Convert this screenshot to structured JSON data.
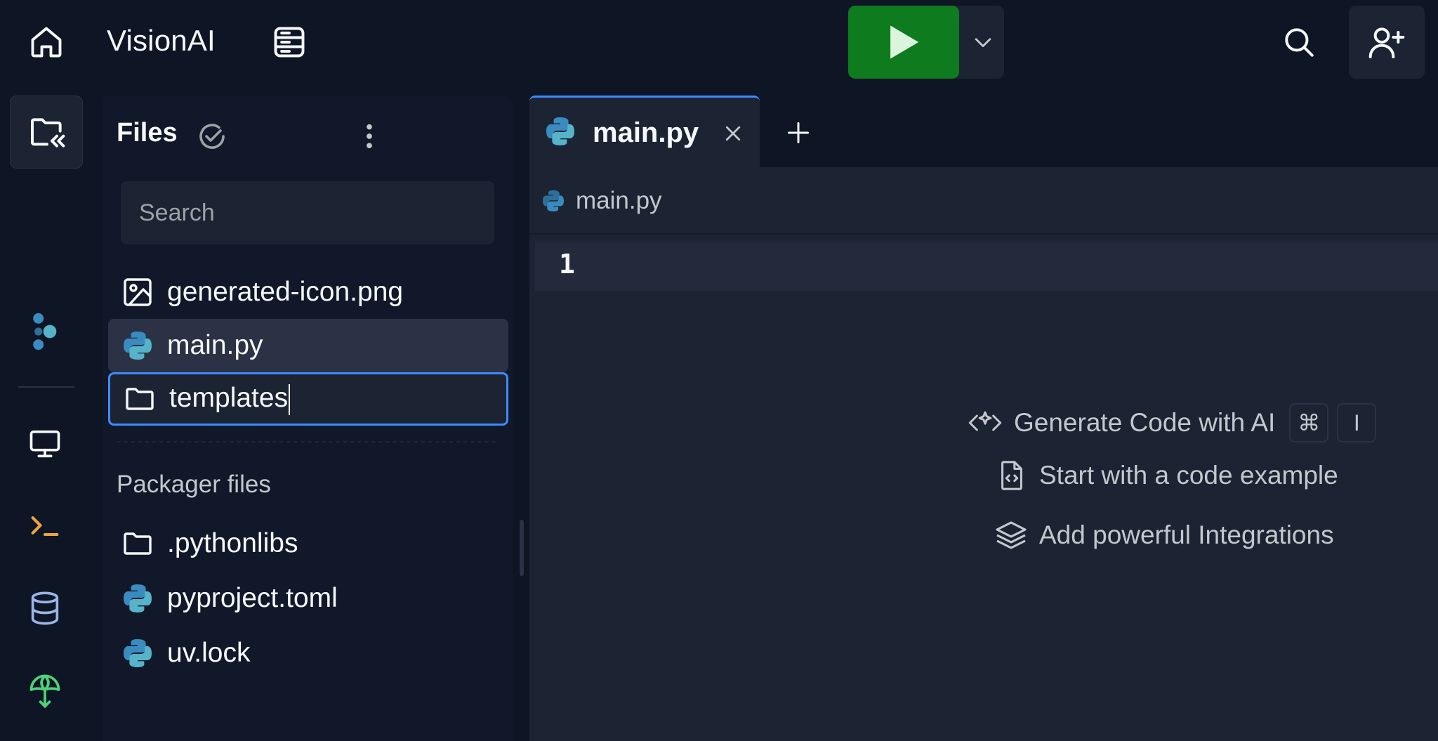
{
  "topbar": {
    "app_name": "VisionAI",
    "icons": {
      "home": "home-icon",
      "app_menu": "workspace-menu-icon",
      "run": "play-icon",
      "run_dropdown": "chevron-down-icon",
      "search": "search-icon",
      "invite": "add-user-icon"
    }
  },
  "rail": {
    "items": [
      "files-collapse-icon",
      "agent-icon",
      "preview-icon",
      "shell-icon",
      "database-icon",
      "deploy-icon"
    ]
  },
  "files": {
    "title": "Files",
    "search_placeholder": "Search",
    "items": [
      {
        "name": "generated-icon.png",
        "icon": "image-file-icon",
        "state": "normal"
      },
      {
        "name": "main.py",
        "icon": "python-icon",
        "state": "selected"
      },
      {
        "name": "templates",
        "icon": "folder-icon",
        "state": "editing"
      }
    ],
    "packager_title": "Packager files",
    "packager_items": [
      {
        "name": ".pythonlibs",
        "icon": "folder-icon"
      },
      {
        "name": "pyproject.toml",
        "icon": "python-icon"
      },
      {
        "name": "uv.lock",
        "icon": "python-icon"
      }
    ]
  },
  "editor": {
    "tab_label": "main.py",
    "breadcrumb": "main.py",
    "line_number": "1",
    "hints": {
      "generate": "Generate Code with AI",
      "kbd_cmd": "⌘",
      "kbd_key": "I",
      "example": "Start with a code example",
      "integrations": "Add powerful Integrations"
    }
  },
  "colors": {
    "background": "#0e1525",
    "panel": "#1c2333",
    "run_green": "#0f7b1f",
    "accent_blue": "#3d8bfd",
    "python_blue": "#3a8bbf"
  }
}
